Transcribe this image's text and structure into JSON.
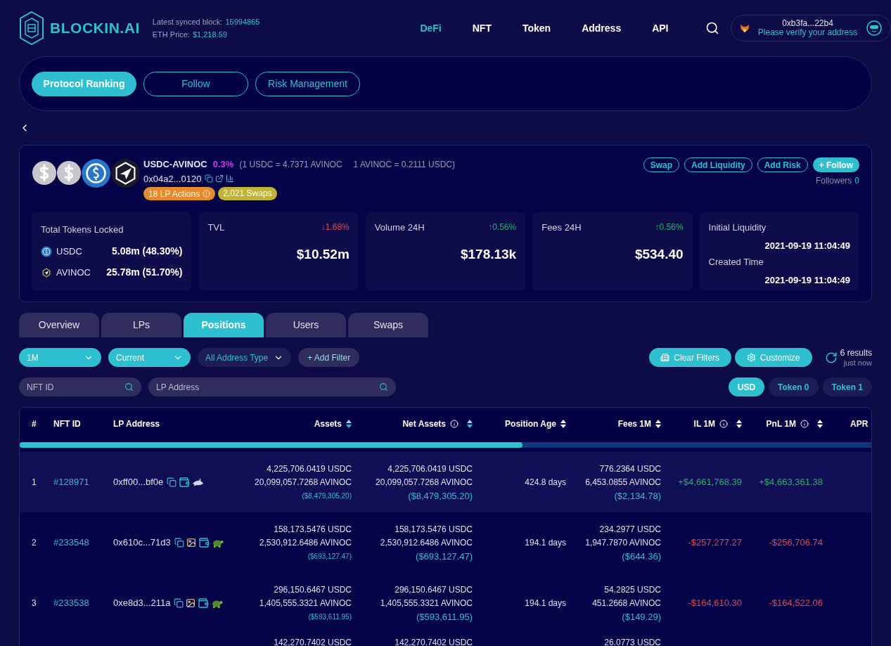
{
  "header": {
    "logo": "BLOCKIN.AI",
    "synced_label": "Latest synced block:",
    "synced_value": "15994865",
    "eth_label": "ETH Price:",
    "eth_value": "$1,218.59",
    "nav": [
      {
        "label": "DeFi",
        "selected": true
      },
      {
        "label": "NFT",
        "selected": false
      },
      {
        "label": "Token",
        "selected": false
      },
      {
        "label": "Address",
        "selected": false
      },
      {
        "label": "API",
        "selected": false
      }
    ],
    "wallet": {
      "address": "0xb3fa...22b4",
      "note": "Please verify your address"
    }
  },
  "section_tabs": [
    {
      "label": "Protocol Ranking",
      "selected": true
    },
    {
      "label": "Follow",
      "selected": false
    },
    {
      "label": "Risk Management",
      "selected": false
    }
  ],
  "pool": {
    "logos": [
      {
        "kind": "dollar"
      },
      {
        "kind": "dollar"
      },
      {
        "kind": "usdc"
      },
      {
        "kind": "avinoc"
      }
    ],
    "name": "USDC-AVINOC",
    "fee": "0.3%",
    "rate1": "(1 USDC = 4.7371 AVINOC",
    "rate2": "1 AVINOC = 0.2111 USDC)",
    "address": "0x04a2...0120",
    "lp_actions": "18 LP Actions",
    "swaps": "2,021 Swaps",
    "actions": [
      {
        "label": "Swap",
        "primary": false
      },
      {
        "label": "Add Liquidity",
        "primary": false
      },
      {
        "label": "Add Risk",
        "primary": false
      },
      {
        "label": "+ Follow",
        "primary": true
      }
    ],
    "followers_label": "Followers",
    "followers_count": "0",
    "locked": {
      "title": "Total Tokens Locked",
      "tokens": [
        {
          "kind": "usdc",
          "symbol": "USDC",
          "amount": "5.08m (48.30%)"
        },
        {
          "kind": "avinoc",
          "symbol": "AVINOC",
          "amount": "25.78m (51.70%)"
        }
      ]
    },
    "stats": [
      {
        "label": "TVL",
        "change": "↓1.68%",
        "rising": false,
        "value": "$10.52m"
      },
      {
        "label": "Volume 24H",
        "change": "↑0.56%",
        "rising": true,
        "value": "$178.13k"
      },
      {
        "label": "Fees 24H",
        "change": "↑0.56%",
        "rising": true,
        "value": "$534.40"
      }
    ],
    "initial_label": "Initial Liquidity",
    "initial_value": "2021-09-19 11:04:49",
    "created_label": "Created Time",
    "created_value": "2021-09-19 11:04:49"
  },
  "tabs": [
    {
      "label": "Overview",
      "selected": false
    },
    {
      "label": "LPs",
      "selected": false
    },
    {
      "label": "Positions",
      "selected": true
    },
    {
      "label": "Users",
      "selected": false
    },
    {
      "label": "Swaps",
      "selected": false
    }
  ],
  "filters": [
    {
      "kind": "dropdown",
      "label": "1M",
      "active": true
    },
    {
      "kind": "dropdown",
      "label": "Current",
      "active": true
    },
    {
      "kind": "dropdown",
      "label": "All Address Type",
      "active": false
    },
    {
      "kind": "button",
      "label": "+ Add Filter",
      "active": false
    }
  ],
  "clear_filters": "Clear Filters",
  "customize": "Customize",
  "results": "6 results",
  "updated": "just now",
  "search_fields": [
    {
      "placeholder": "NFT ID"
    },
    {
      "placeholder": "LP Address"
    }
  ],
  "units": [
    {
      "label": "USD",
      "selected": true
    },
    {
      "label": "Token 0",
      "selected": false
    },
    {
      "label": "Token 1",
      "selected": false
    }
  ],
  "table": {
    "columns": [
      {
        "label": "#"
      },
      {
        "label": "NFT ID"
      },
      {
        "label": "LP Address"
      },
      {
        "label": "Assets",
        "sorted": true
      },
      {
        "label": "Net Assets",
        "info": true,
        "sorted": true
      },
      {
        "label": "Position Age",
        "sorted": false
      },
      {
        "label": "Fees 1M",
        "sorted": false
      },
      {
        "label": "IL 1M",
        "info": true,
        "sorted": false
      },
      {
        "label": "PnL 1M",
        "info": true,
        "sorted": false
      },
      {
        "label": "APR"
      }
    ],
    "rows": [
      {
        "kind": "full",
        "index": "1",
        "nft": "#128971",
        "address": "0xff00...bf0e",
        "icons": [
          {
            "kind": "copy"
          },
          {
            "kind": "wallet"
          },
          {
            "kind": "shark"
          }
        ],
        "hovered": true,
        "assets": [
          "4,225,706.0419 USDC",
          "20,099,057.7268 AVINOC",
          "($8,479,305.20)"
        ],
        "net": [
          "4,225,706.0419 USDC",
          "20,099,057.7268 AVINOC",
          "($8,479,305.20)"
        ],
        "age": "424.8 days",
        "fees": [
          "776.2364 USDC",
          "6,453.0855 AVINOC",
          "($2,134.78)"
        ],
        "il": {
          "value": "+$4,661,768.39",
          "positive": true
        },
        "pnl": {
          "value": "+$4,663,361.38",
          "positive": true
        }
      },
      {
        "kind": "full",
        "index": "2",
        "nft": "#233548",
        "address": "0x610c...71d3",
        "icons": [
          {
            "kind": "copy"
          },
          {
            "kind": "nft"
          },
          {
            "kind": "wallet"
          },
          {
            "kind": "turtle"
          }
        ],
        "hovered": false,
        "assets": [
          "158,173.5476 USDC",
          "2,530,912.6486 AVINOC",
          "($693,127.47)"
        ],
        "net": [
          "158,173.5476 USDC",
          "2,530,912.6486 AVINOC",
          "($693,127.47)"
        ],
        "age": "194.1 days",
        "fees": [
          "234.2977 USDC",
          "1,947.7870 AVINOC",
          "($644.36)"
        ],
        "il": {
          "value": "-$257,277.27",
          "positive": false
        },
        "pnl": {
          "value": "-$256,706.74",
          "positive": false
        }
      },
      {
        "kind": "full",
        "index": "3",
        "nft": "#233538",
        "address": "0xe8d3...211a",
        "icons": [
          {
            "kind": "copy"
          },
          {
            "kind": "nft"
          },
          {
            "kind": "wallet"
          },
          {
            "kind": "turtle"
          }
        ],
        "hovered": false,
        "assets": [
          "296,150.6467 USDC",
          "1,405,555.3321 AVINOC",
          "($593,611.95)"
        ],
        "net": [
          "296,150.6467 USDC",
          "1,405,555.3321 AVINOC",
          "($593,611.95)"
        ],
        "age": "194.1 days",
        "fees": [
          "54.2825 USDC",
          "451.2668 AVINOC",
          "($149.29)"
        ],
        "il": {
          "value": "-$164,610.30",
          "positive": false
        },
        "pnl": {
          "value": "-$164,522.06",
          "positive": false
        }
      },
      {
        "kind": "partial",
        "assets": [
          "142,270.7402 USDC"
        ],
        "net": [
          "142,270.7402 USDC"
        ],
        "fees": [
          "26.0773 USDC"
        ]
      }
    ]
  }
}
